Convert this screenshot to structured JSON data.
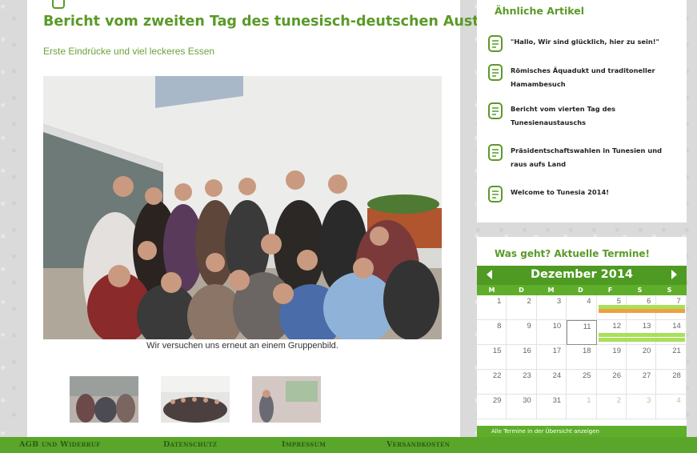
{
  "article": {
    "title": "Bericht vom zweiten Tag des tunesisch-deutschen Austauschs",
    "subtitle": "Erste Eindrücke und viel leckeres Essen",
    "caption": "Wir versuchen uns erneut an einem Gruppenbild."
  },
  "sidebar": {
    "related_title": "Ähnliche Artikel",
    "related": [
      {
        "label": "\"Hallo, Wir sind glücklich, hier zu sein!\""
      },
      {
        "label": "Römisches Äquadukt und traditoneller Hamambesuch"
      },
      {
        "label": "Bericht vom vierten Tag des Tunesienaustauschs"
      },
      {
        "label": "Präsidentschaftswahlen in Tunesien und raus aufs Land"
      },
      {
        "label": "Welcome to Tunesia 2014!"
      }
    ],
    "calendar_title": "Was geht? Aktuelle Termine!",
    "calendar": {
      "month": "Dezember 2014",
      "weekdays": [
        "M",
        "D",
        "M",
        "D",
        "F",
        "S",
        "S"
      ],
      "weeks": [
        [
          "1",
          "2",
          "3",
          "4",
          "5",
          "6",
          "7"
        ],
        [
          "8",
          "9",
          "10",
          "11",
          "12",
          "13",
          "14"
        ],
        [
          "15",
          "16",
          "17",
          "18",
          "19",
          "20",
          "21"
        ],
        [
          "22",
          "23",
          "24",
          "25",
          "26",
          "27",
          "28"
        ],
        [
          "29",
          "30",
          "31",
          "1",
          "2",
          "3",
          "4"
        ]
      ],
      "today": "11",
      "footer_text": "Alle Termine in der Übersicht anzeigen"
    }
  },
  "footer": {
    "links": [
      "AGB und Widerruf",
      "Datenschutz",
      "Impressum",
      "Versandkosten"
    ]
  },
  "colors": {
    "brand_green": "#5a9a28",
    "calendar_green": "#4e9a22",
    "event_green": "#a8e05a",
    "event_orange": "#f0a040"
  }
}
